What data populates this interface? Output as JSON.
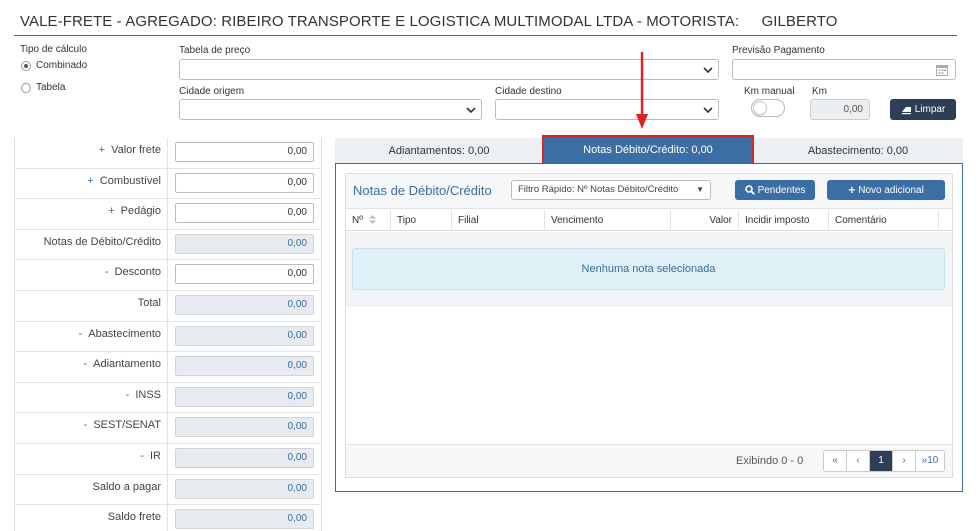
{
  "title": "VALE-FRETE - AGREGADO: RIBEIRO TRANSPORTE E LOGISTICA MULTIMODAL LTDA - MOTORISTA:",
  "driver": "GILBERTO",
  "form": {
    "tipo_calculo_label": "Tipo de cálculo",
    "radio_combinado": "Combinado",
    "radio_tabela": "Tabela",
    "tabela_preco_label": "Tabela de preço",
    "previsao_label": "Previsão Pagamento",
    "cidade_origem_label": "Cidade origem",
    "cidade_destino_label": "Cidade destino",
    "km_manual_label": "Km manual",
    "km_label": "Km",
    "km_value": "0,00",
    "limpar_label": "Limpar"
  },
  "totals": [
    {
      "sign": "+",
      "label": "Valor frete",
      "value": "0,00",
      "readonly": false
    },
    {
      "sign": "+",
      "label": "Combustível",
      "value": "0,00",
      "readonly": false
    },
    {
      "sign": "+",
      "label": "Pedágio",
      "value": "0,00",
      "readonly": false
    },
    {
      "sign": "",
      "label": "Notas de Débito/Crédito",
      "value": "0,00",
      "readonly": true
    },
    {
      "sign": "-",
      "label": "Desconto",
      "value": "0,00",
      "readonly": false
    },
    {
      "sign": "",
      "label": "Total",
      "value": "0,00",
      "readonly": true
    },
    {
      "sign": "-",
      "label": "Abastecimento",
      "value": "0,00",
      "readonly": true
    },
    {
      "sign": "-",
      "label": "Adiantamento",
      "value": "0,00",
      "readonly": true
    },
    {
      "sign": "-",
      "label": "INSS",
      "value": "0,00",
      "readonly": true
    },
    {
      "sign": "-",
      "label": "SEST/SENAT",
      "value": "0,00",
      "readonly": true
    },
    {
      "sign": "-",
      "label": "IR",
      "value": "0,00",
      "readonly": true
    },
    {
      "sign": "",
      "label": "Saldo a pagar",
      "value": "0,00",
      "readonly": true
    },
    {
      "sign": "",
      "label": "Saldo frete",
      "value": "0,00",
      "readonly": true
    }
  ],
  "tabs": {
    "adiantamentos": "Adiantamentos: 0,00",
    "notas": "Notas Débito/Crédito: 0,00",
    "abastecimento": "Abastecimento: 0,00"
  },
  "notes": {
    "title": "Notas de Débito/Crédito",
    "filter": "Filtro Rápido: Nº Notas Débito/Crédito",
    "pendentes_label": "Pendentes",
    "novo_label": "Novo adicional",
    "columns": [
      "Nº",
      "Tipo",
      "Filial",
      "Vencimento",
      "Valor",
      "Incidir imposto",
      "Comentário"
    ],
    "empty": "Nenhuma nota selecionada",
    "exibindo": "Exibindo 0 - 0",
    "pager": [
      "«",
      "‹",
      "1",
      "›",
      "»10"
    ]
  },
  "colors": {
    "accent": "#3b6ea5",
    "dark": "#2d3e55",
    "highlight": "#d9262a"
  }
}
